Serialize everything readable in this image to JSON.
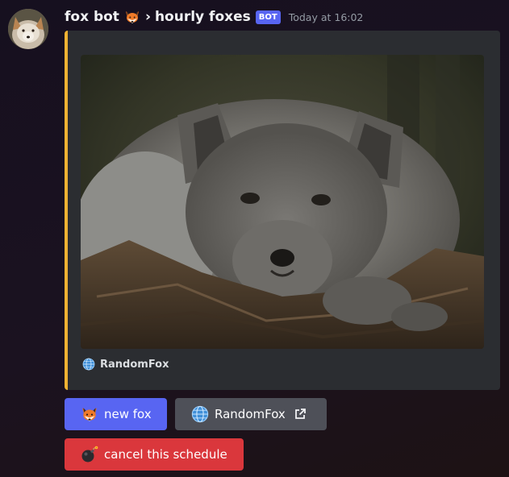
{
  "message": {
    "author": "fox bot",
    "author_emoji": "fox-face-emoji",
    "separator": "›",
    "channel": "hourly foxes",
    "bot_badge": "BOT",
    "timestamp": "Today at 16:02"
  },
  "embed": {
    "accent_color": "#f0b232",
    "image_alt": "arctic fox lying on a log",
    "footer_icon": "globe-icon",
    "footer_text": "RandomFox"
  },
  "buttons": {
    "new_fox": {
      "label": "new fox",
      "emoji": "fox-face-emoji",
      "color": "#5865f2"
    },
    "random_fox": {
      "label": "RandomFox",
      "emoji": "globe-emoji",
      "trailing_icon": "external-link-icon",
      "color": "#4e5058"
    },
    "cancel": {
      "label": "cancel this schedule",
      "emoji": "bomb-emoji",
      "color": "#da373c"
    }
  }
}
